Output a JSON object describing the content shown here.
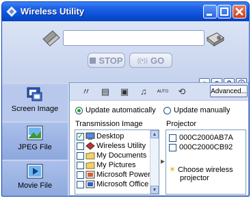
{
  "window": {
    "title": "Wireless Utility"
  },
  "controls": {
    "stop_label": "STOP",
    "go_label": "GO",
    "go_wave": "((•))"
  },
  "help_buttons": [
    {
      "icon": "pin-icon",
      "glyph": "♀"
    },
    {
      "icon": "settings-icon",
      "glyph": "⚙"
    },
    {
      "icon": "help-icon",
      "glyph": "?"
    },
    {
      "icon": "info-icon",
      "glyph": "ⓘ"
    }
  ],
  "side_tabs": [
    {
      "label": "Screen Image",
      "icon": "screen-image-icon",
      "active": true
    },
    {
      "label": "JPEG File",
      "icon": "jpeg-file-icon",
      "active": false
    },
    {
      "label": "Movie File",
      "icon": "movie-file-icon",
      "active": false
    }
  ],
  "toolbar": {
    "icons": [
      "signal-icon",
      "display-icon",
      "document-icon",
      "music-icon",
      "auto-icon",
      "loop-icon"
    ],
    "advanced_label": "Advanced..."
  },
  "update": {
    "auto_label": "Update automatically",
    "manual_label": "Update manually",
    "selected": "auto"
  },
  "transmission": {
    "label": "Transmission Image",
    "items": [
      {
        "label": "Desktop",
        "checked": true,
        "icon": "desktop-icon"
      },
      {
        "label": "Wireless Utility",
        "checked": false,
        "icon": "app-icon"
      },
      {
        "label": "My Documents",
        "checked": false,
        "icon": "folder-icon"
      },
      {
        "label": "My Pictures",
        "checked": false,
        "icon": "folder-icon"
      },
      {
        "label": "Microsoft Power",
        "checked": false,
        "icon": "powerpoint-icon"
      },
      {
        "label": "Microsoft Office",
        "checked": false,
        "icon": "office-icon"
      }
    ]
  },
  "projector": {
    "label": "Projector",
    "items": [
      {
        "label": "000C2000AB7A",
        "checked": false
      },
      {
        "label": "000C2000CB92",
        "checked": false
      }
    ],
    "choose_line1": "Choose wireless",
    "choose_line2": "projector"
  },
  "colors": {
    "titlebar": "#0a4fd8",
    "panel_bg": "#c8d4ec",
    "accent_green": "#21a121"
  }
}
